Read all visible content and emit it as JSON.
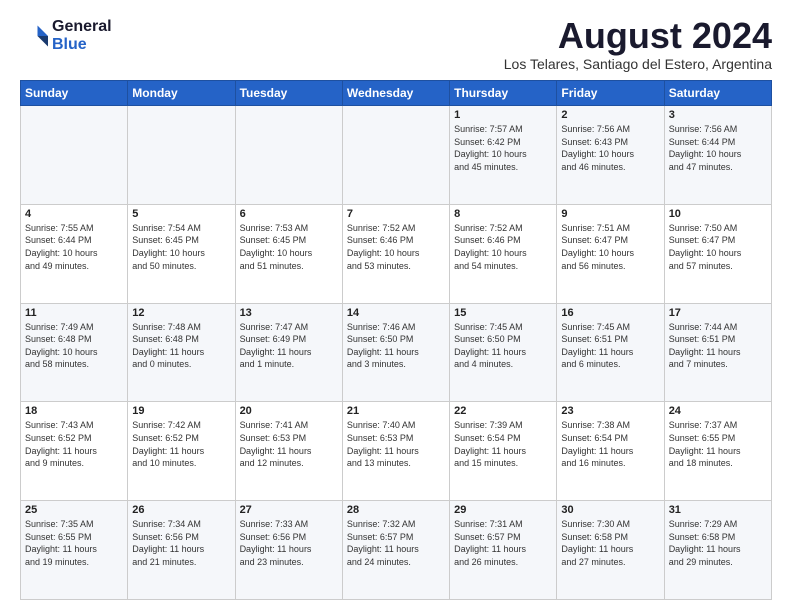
{
  "logo": {
    "line1": "General",
    "line2": "Blue"
  },
  "title": "August 2024",
  "subtitle": "Los Telares, Santiago del Estero, Argentina",
  "days_of_week": [
    "Sunday",
    "Monday",
    "Tuesday",
    "Wednesday",
    "Thursday",
    "Friday",
    "Saturday"
  ],
  "weeks": [
    [
      {
        "day": "",
        "info": ""
      },
      {
        "day": "",
        "info": ""
      },
      {
        "day": "",
        "info": ""
      },
      {
        "day": "",
        "info": ""
      },
      {
        "day": "1",
        "info": "Sunrise: 7:57 AM\nSunset: 6:42 PM\nDaylight: 10 hours\nand 45 minutes."
      },
      {
        "day": "2",
        "info": "Sunrise: 7:56 AM\nSunset: 6:43 PM\nDaylight: 10 hours\nand 46 minutes."
      },
      {
        "day": "3",
        "info": "Sunrise: 7:56 AM\nSunset: 6:44 PM\nDaylight: 10 hours\nand 47 minutes."
      }
    ],
    [
      {
        "day": "4",
        "info": "Sunrise: 7:55 AM\nSunset: 6:44 PM\nDaylight: 10 hours\nand 49 minutes."
      },
      {
        "day": "5",
        "info": "Sunrise: 7:54 AM\nSunset: 6:45 PM\nDaylight: 10 hours\nand 50 minutes."
      },
      {
        "day": "6",
        "info": "Sunrise: 7:53 AM\nSunset: 6:45 PM\nDaylight: 10 hours\nand 51 minutes."
      },
      {
        "day": "7",
        "info": "Sunrise: 7:52 AM\nSunset: 6:46 PM\nDaylight: 10 hours\nand 53 minutes."
      },
      {
        "day": "8",
        "info": "Sunrise: 7:52 AM\nSunset: 6:46 PM\nDaylight: 10 hours\nand 54 minutes."
      },
      {
        "day": "9",
        "info": "Sunrise: 7:51 AM\nSunset: 6:47 PM\nDaylight: 10 hours\nand 56 minutes."
      },
      {
        "day": "10",
        "info": "Sunrise: 7:50 AM\nSunset: 6:47 PM\nDaylight: 10 hours\nand 57 minutes."
      }
    ],
    [
      {
        "day": "11",
        "info": "Sunrise: 7:49 AM\nSunset: 6:48 PM\nDaylight: 10 hours\nand 58 minutes."
      },
      {
        "day": "12",
        "info": "Sunrise: 7:48 AM\nSunset: 6:48 PM\nDaylight: 11 hours\nand 0 minutes."
      },
      {
        "day": "13",
        "info": "Sunrise: 7:47 AM\nSunset: 6:49 PM\nDaylight: 11 hours\nand 1 minute."
      },
      {
        "day": "14",
        "info": "Sunrise: 7:46 AM\nSunset: 6:50 PM\nDaylight: 11 hours\nand 3 minutes."
      },
      {
        "day": "15",
        "info": "Sunrise: 7:45 AM\nSunset: 6:50 PM\nDaylight: 11 hours\nand 4 minutes."
      },
      {
        "day": "16",
        "info": "Sunrise: 7:45 AM\nSunset: 6:51 PM\nDaylight: 11 hours\nand 6 minutes."
      },
      {
        "day": "17",
        "info": "Sunrise: 7:44 AM\nSunset: 6:51 PM\nDaylight: 11 hours\nand 7 minutes."
      }
    ],
    [
      {
        "day": "18",
        "info": "Sunrise: 7:43 AM\nSunset: 6:52 PM\nDaylight: 11 hours\nand 9 minutes."
      },
      {
        "day": "19",
        "info": "Sunrise: 7:42 AM\nSunset: 6:52 PM\nDaylight: 11 hours\nand 10 minutes."
      },
      {
        "day": "20",
        "info": "Sunrise: 7:41 AM\nSunset: 6:53 PM\nDaylight: 11 hours\nand 12 minutes."
      },
      {
        "day": "21",
        "info": "Sunrise: 7:40 AM\nSunset: 6:53 PM\nDaylight: 11 hours\nand 13 minutes."
      },
      {
        "day": "22",
        "info": "Sunrise: 7:39 AM\nSunset: 6:54 PM\nDaylight: 11 hours\nand 15 minutes."
      },
      {
        "day": "23",
        "info": "Sunrise: 7:38 AM\nSunset: 6:54 PM\nDaylight: 11 hours\nand 16 minutes."
      },
      {
        "day": "24",
        "info": "Sunrise: 7:37 AM\nSunset: 6:55 PM\nDaylight: 11 hours\nand 18 minutes."
      }
    ],
    [
      {
        "day": "25",
        "info": "Sunrise: 7:35 AM\nSunset: 6:55 PM\nDaylight: 11 hours\nand 19 minutes."
      },
      {
        "day": "26",
        "info": "Sunrise: 7:34 AM\nSunset: 6:56 PM\nDaylight: 11 hours\nand 21 minutes."
      },
      {
        "day": "27",
        "info": "Sunrise: 7:33 AM\nSunset: 6:56 PM\nDaylight: 11 hours\nand 23 minutes."
      },
      {
        "day": "28",
        "info": "Sunrise: 7:32 AM\nSunset: 6:57 PM\nDaylight: 11 hours\nand 24 minutes."
      },
      {
        "day": "29",
        "info": "Sunrise: 7:31 AM\nSunset: 6:57 PM\nDaylight: 11 hours\nand 26 minutes."
      },
      {
        "day": "30",
        "info": "Sunrise: 7:30 AM\nSunset: 6:58 PM\nDaylight: 11 hours\nand 27 minutes."
      },
      {
        "day": "31",
        "info": "Sunrise: 7:29 AM\nSunset: 6:58 PM\nDaylight: 11 hours\nand 29 minutes."
      }
    ]
  ]
}
